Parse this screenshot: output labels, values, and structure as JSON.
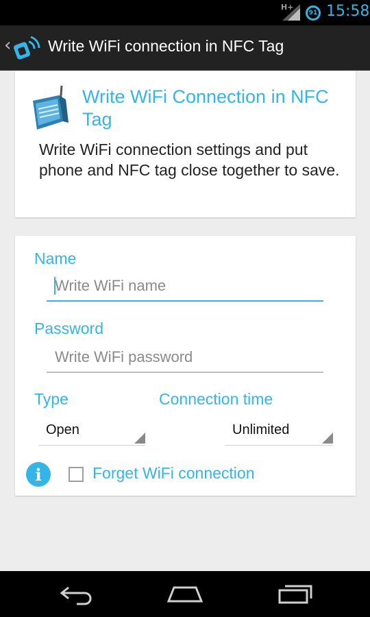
{
  "status_bar": {
    "network": "H+",
    "badge": "91",
    "time": "15:58"
  },
  "action_bar": {
    "title": "Write WiFi connection in NFC Tag",
    "back_icon": "chevron-left-icon",
    "app_icon": "nfc-app-icon"
  },
  "header_card": {
    "title": "Write WiFi Connection in NFC Tag",
    "description": "Write WiFi connection settings and put phone and NFC tag close together to save.",
    "icon": "wifi-router-icon"
  },
  "form": {
    "name_label": "Name",
    "name_placeholder": "Write WiFi name",
    "password_label": "Password",
    "password_placeholder": "Write WiFi password",
    "type_label": "Type",
    "type_value": "Open",
    "connection_time_label": "Connection time",
    "connection_time_value": "Unlimited",
    "forget_label": "Forget WiFi connection",
    "forget_checked": false
  },
  "nav_bar": {
    "back": "back-icon",
    "home": "home-icon",
    "recent": "recent-apps-icon"
  },
  "colors": {
    "accent": "#33b5e5",
    "action_bar": "#222222",
    "background": "#ededed"
  }
}
